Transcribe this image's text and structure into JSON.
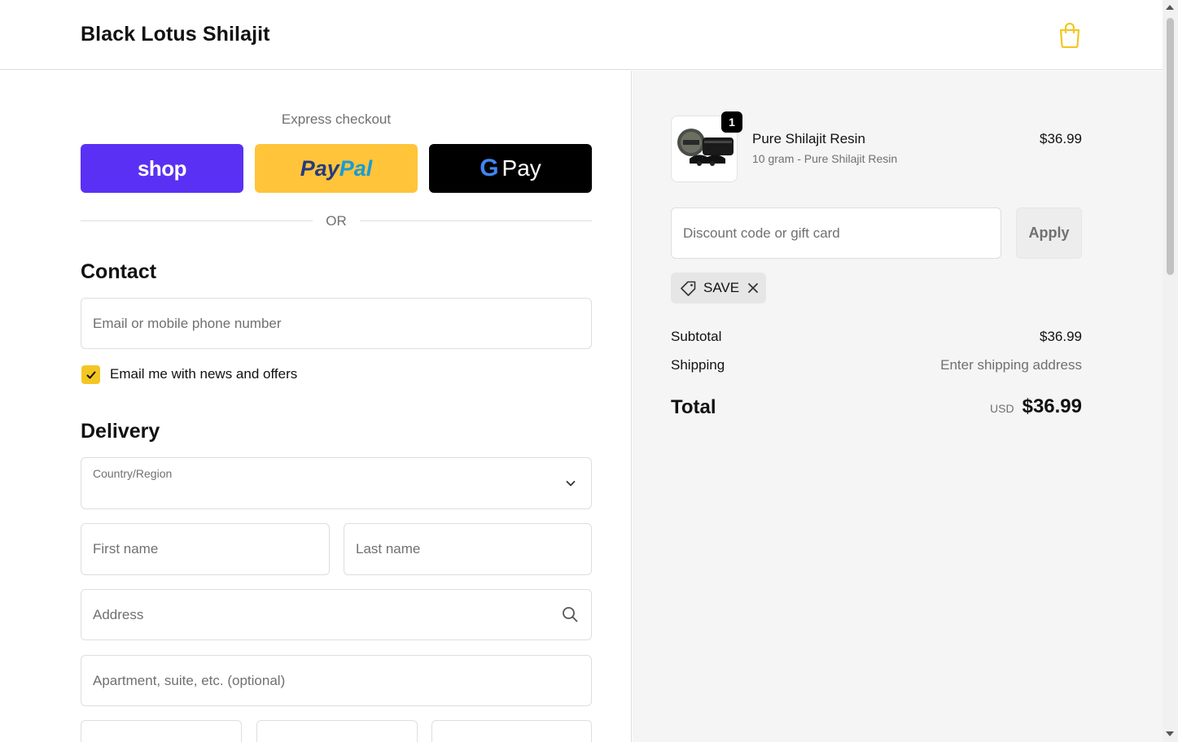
{
  "header": {
    "brand": "Black Lotus Shilajit"
  },
  "express": {
    "title": "Express checkout",
    "shop_label": "shop",
    "paypal_part1": "Pay",
    "paypal_part2": "Pal",
    "gpay_g": "G",
    "gpay_label": "Pay",
    "or_label": "OR"
  },
  "contact": {
    "title": "Contact",
    "email_placeholder": "Email or mobile phone number",
    "news_label": "Email me with news and offers",
    "news_checked": true
  },
  "delivery": {
    "title": "Delivery",
    "country_label": "Country/Region",
    "first_name_placeholder": "First name",
    "last_name_placeholder": "Last name",
    "address_placeholder": "Address",
    "apartment_placeholder": "Apartment, suite, etc. (optional)"
  },
  "order": {
    "item": {
      "quantity": "1",
      "name": "Pure Shilajit Resin",
      "variant": "10 gram - Pure Shilajit Resin",
      "price": "$36.99"
    },
    "discount_placeholder": "Discount code or gift card",
    "apply_label": "Apply",
    "applied_code": "SAVE",
    "subtotal_label": "Subtotal",
    "subtotal_value": "$36.99",
    "shipping_label": "Shipping",
    "shipping_value": "Enter shipping address",
    "total_label": "Total",
    "total_currency": "USD",
    "total_value": "$36.99"
  },
  "colors": {
    "accent": "#f3c623",
    "shop": "#5a31f4",
    "paypal": "#ffc439",
    "gpay": "#000000"
  }
}
